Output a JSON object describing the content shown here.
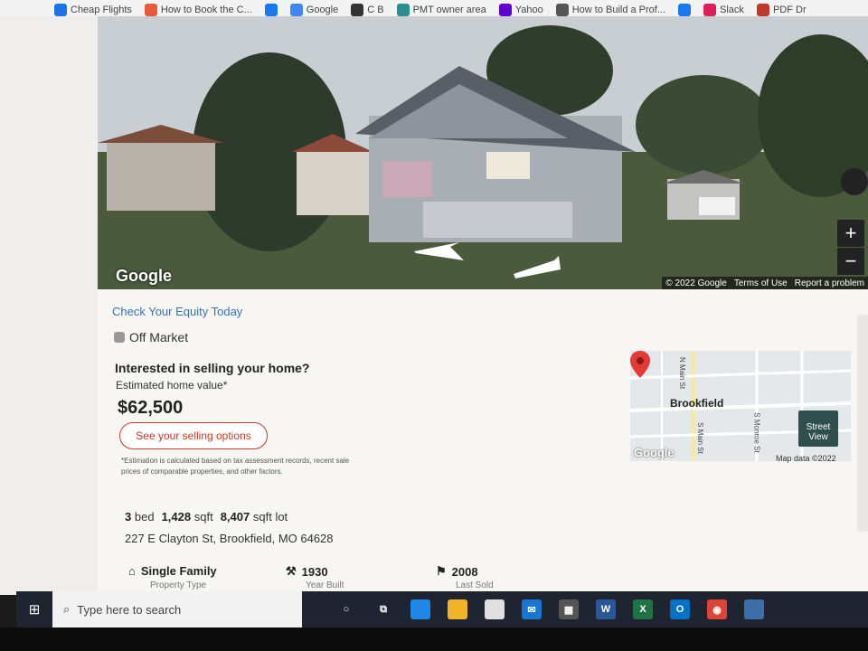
{
  "bookmarks": [
    {
      "label": "Cheap Flights",
      "icon": "bookmark-icon",
      "color": "#1a73e8"
    },
    {
      "label": "How to Book the C...",
      "icon": "bookmark-icon",
      "color": "#e8573e"
    },
    {
      "label": "",
      "icon": "facebook-icon",
      "color": "#1877f2"
    },
    {
      "label": "Google",
      "icon": "google-icon",
      "color": "#4285f4"
    },
    {
      "label": "C B",
      "icon": "cb-icon",
      "color": "#333"
    },
    {
      "label": "PMT owner area",
      "icon": "pmt-icon",
      "color": "#2a8f8f"
    },
    {
      "label": "Yahoo",
      "icon": "yahoo-icon",
      "color": "#5f01d1"
    },
    {
      "label": "How to Build a Prof...",
      "icon": "globe-icon",
      "color": "#555"
    },
    {
      "label": "",
      "icon": "facebook-icon",
      "color": "#1877f2"
    },
    {
      "label": "Slack",
      "icon": "slack-icon",
      "color": "#e01e5a"
    },
    {
      "label": "PDF Dr",
      "icon": "pdf-icon",
      "color": "#c0392b"
    }
  ],
  "street_view": {
    "brand": "Google",
    "copyright": "© 2022 Google",
    "terms": "Terms of Use",
    "report": "Report a problem",
    "zoom_in": "+",
    "zoom_out": "−"
  },
  "listing": {
    "equity_link": "Check Your Equity Today",
    "status": "Off Market",
    "interested": "Interested in selling your home?",
    "estimated_label": "Estimated home value*",
    "price": "$62,500",
    "sell_button": "See your selling options",
    "estimation_note": "*Estimation is calculated based on tax assessment records, recent sale prices of comparable properties, and other factors."
  },
  "map": {
    "city": "Brookfield",
    "brand": "Google",
    "map_data": "Map data ©2022",
    "street_view_btn": "Street View",
    "roads": [
      "N Main St",
      "S Main St",
      "S Monroe St"
    ]
  },
  "facts": {
    "beds_value": "3",
    "beds_label": "bed",
    "sqft_value": "1,428",
    "sqft_label": "sqft",
    "lot_value": "8,407",
    "lot_label": "sqft lot",
    "address": "227 E Clayton St, Brookfield, MO 64628"
  },
  "properties": [
    {
      "value": "Single Family",
      "label": "Property Type",
      "icon": "house-icon"
    },
    {
      "value": "1930",
      "label": "Year Built",
      "icon": "hammer-icon"
    },
    {
      "value": "2008",
      "label": "Last Sold",
      "icon": "flag-icon"
    }
  ],
  "taskbar": {
    "search_placeholder": "Type here to search",
    "apps": [
      "cortana-icon",
      "task-view-icon",
      "edge-icon",
      "file-explorer-icon",
      "store-icon",
      "mail-icon",
      "calculator-icon",
      "word-icon",
      "excel-icon",
      "outlook-icon",
      "chrome-icon",
      "app-icon"
    ]
  }
}
